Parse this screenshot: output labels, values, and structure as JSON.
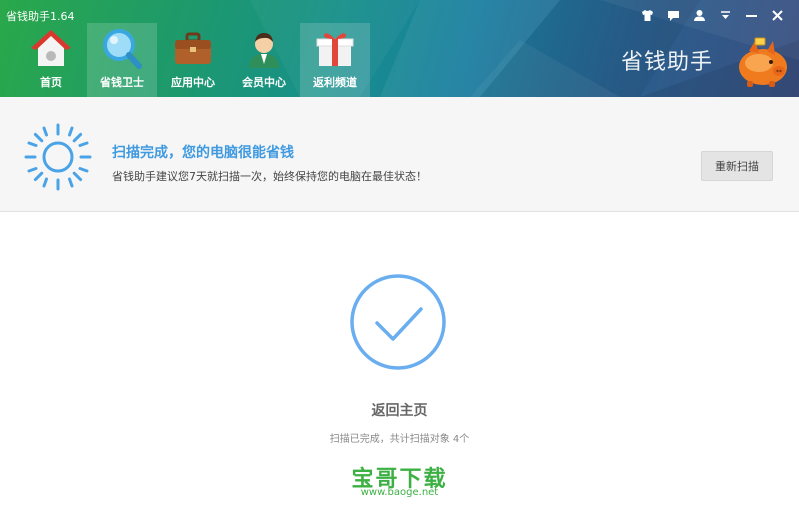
{
  "app": {
    "title": "省钱助手1.64",
    "brand_text": "省钱助手"
  },
  "nav": {
    "items": [
      {
        "label": "首页",
        "icon": "house-icon",
        "active": false
      },
      {
        "label": "省钱卫士",
        "icon": "magnifier-icon",
        "active": true
      },
      {
        "label": "应用中心",
        "icon": "briefcase-icon",
        "active": false
      },
      {
        "label": "会员中心",
        "icon": "user-avatar-icon",
        "active": false
      },
      {
        "label": "返利频道",
        "icon": "gift-icon",
        "active": false
      }
    ]
  },
  "window_controls": [
    {
      "name": "skin-icon",
      "glyph": "tshirt"
    },
    {
      "name": "message-icon",
      "glyph": "chat"
    },
    {
      "name": "account-icon",
      "glyph": "person"
    },
    {
      "name": "menu-icon",
      "glyph": "triangle-down"
    },
    {
      "name": "minimize-icon",
      "glyph": "minus"
    },
    {
      "name": "close-icon",
      "glyph": "x"
    }
  ],
  "status": {
    "icon": "sun-icon",
    "title": "扫描完成，您的电脑很能省钱",
    "description": "省钱助手建议您7天就扫描一次，始终保持您的电脑在最佳状态！",
    "rescan_label": "重新扫描"
  },
  "result": {
    "icon": "checkmark-circle-icon",
    "back_label": "返回主页",
    "summary": "扫描已完成，共计扫描对象 4个"
  },
  "watermark": {
    "text": "宝哥下载",
    "url": "www.baoge.net"
  },
  "colors": {
    "accent_blue": "#3f9ae0",
    "check_blue": "#6aaef0",
    "watermark_green": "#3cb043",
    "header_green": "#2aa84a",
    "header_blue": "#2a5f8e"
  }
}
